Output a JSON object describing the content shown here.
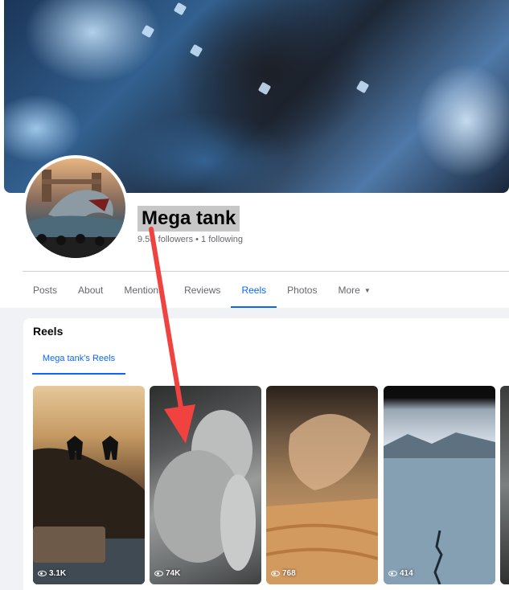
{
  "profile": {
    "name": "Mega tank",
    "stats": "9.5K followers • 1 following"
  },
  "tabs": [
    {
      "label": "Posts",
      "active": false
    },
    {
      "label": "About",
      "active": false
    },
    {
      "label": "Mentions",
      "active": false
    },
    {
      "label": "Reviews",
      "active": false
    },
    {
      "label": "Reels",
      "active": true
    },
    {
      "label": "Photos",
      "active": false
    },
    {
      "label": "More",
      "active": false
    }
  ],
  "reels_section": {
    "title": "Reels",
    "subtab": "Mega tank's Reels",
    "items": [
      {
        "views": "3.1K"
      },
      {
        "views": "74K"
      },
      {
        "views": "768"
      },
      {
        "views": "414"
      }
    ]
  },
  "colors": {
    "accent": "#0866ff",
    "annotation_arrow": "#f0433f",
    "highlight": "#c7c7c7"
  },
  "icons": [
    "eye-icon",
    "caret-down-icon"
  ]
}
